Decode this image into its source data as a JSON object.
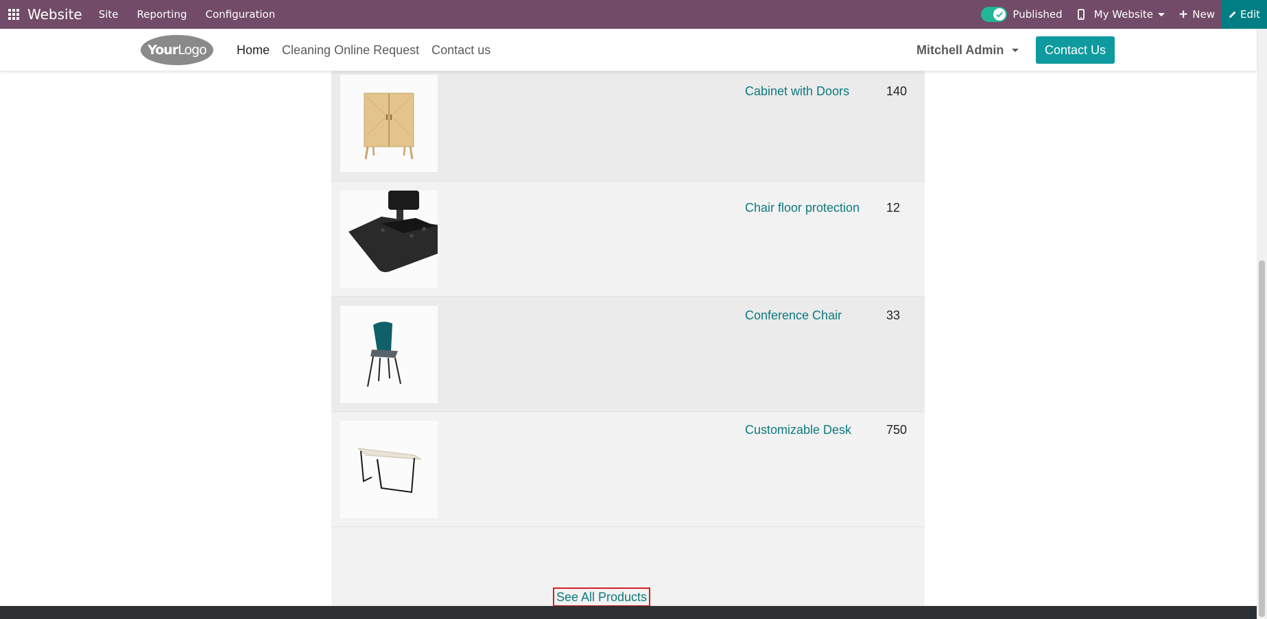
{
  "adminbar": {
    "app_title": "Website",
    "menu": [
      "Site",
      "Reporting",
      "Configuration"
    ],
    "published_label": "Published",
    "website_selector": "My Website",
    "new_label": "New",
    "edit_label": "Edit",
    "bar_color": "#714B67",
    "edit_color": "#017E84",
    "toggle_color": "#21B799",
    "icons": [
      "apps-grid-icon",
      "check-icon",
      "mobile-icon",
      "plus-icon",
      "pencil-icon"
    ]
  },
  "header": {
    "logo_text_bold": "Your",
    "logo_text": "Logo",
    "nav": [
      "Home",
      "Cleaning Online Request",
      "Contact us"
    ],
    "user_name": "Mitchell Admin",
    "contact_button": "Contact Us",
    "accent_color": "#0E9A9E"
  },
  "products": [
    {
      "name": "Cabinet with Doors",
      "qty": "140",
      "image": "cabinet-image"
    },
    {
      "name": "Chair floor protection",
      "qty": "12",
      "image": "floor-mat-image"
    },
    {
      "name": "Conference Chair",
      "qty": "33",
      "image": "chair-image"
    },
    {
      "name": "Customizable Desk",
      "qty": "750",
      "image": "desk-image"
    }
  ],
  "see_all_label": "See All Products"
}
